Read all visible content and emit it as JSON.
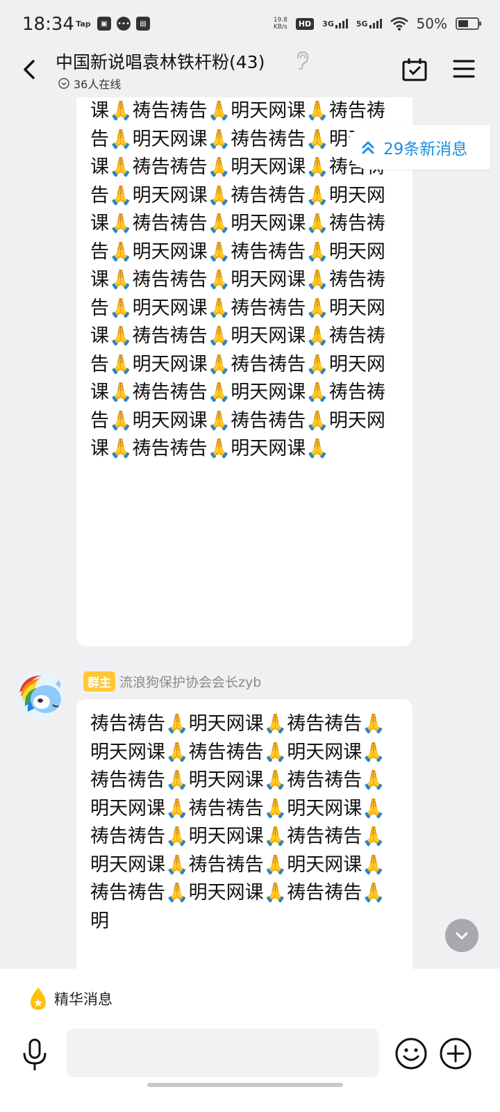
{
  "status_bar": {
    "time": "18:34",
    "app_icons": [
      "Tap",
      "gallery-icon",
      "message-icon",
      "inbox-icon"
    ],
    "net_speed": "19.8",
    "net_unit": "KB/s",
    "hd_label": "HD",
    "sim1": "3G",
    "sim2": "5G",
    "battery": "50%"
  },
  "header": {
    "title": "中国新说唱袁林铁杆粉(43)",
    "online": "36人在线"
  },
  "messages": [
    {
      "text": "课🙏祷告祷告🙏明天网课🙏祷告祷告🙏明天网课🙏祷告祷告🙏明天网课🙏祷告祷告🙏明天网课🙏祷告祷告🙏明天网课🙏祷告祷告🙏明天网课🙏祷告祷告🙏明天网课🙏祷告祷告🙏明天网课🙏祷告祷告🙏明天网课🙏祷告祷告🙏明天网课🙏祷告祷告🙏明天网课🙏祷告祷告🙏明天网课🙏祷告祷告🙏明天网课🙏祷告祷告🙏明天网课🙏祷告祷告🙏明天网课🙏祷告祷告🙏明天网课🙏祷告祷告🙏明天网课🙏祷告祷告🙏明天网课🙏祷告祷告🙏明天网课🙏"
    },
    {
      "badge": "群主",
      "sender": "流浪狗保护协会会长zyb",
      "text": "祷告祷告🙏明天网课🙏祷告祷告🙏明天网课🙏祷告祷告🙏明天网课🙏祷告祷告🙏明天网课🙏祷告祷告🙏明天网课🙏祷告祷告🙏明天网课🙏祷告祷告🙏明天网课🙏祷告祷告🙏明天网课🙏祷告祷告🙏明天网课🙏祷告祷告🙏明天网课🙏祷告祷告🙏明"
    }
  ],
  "new_messages": "29条新消息",
  "essence": "精华消息",
  "input": {
    "value": "",
    "placeholder": ""
  },
  "colors": {
    "accent": "#1a8fe0",
    "owner_badge": "#ffc933",
    "background": "#f0f0f2"
  }
}
